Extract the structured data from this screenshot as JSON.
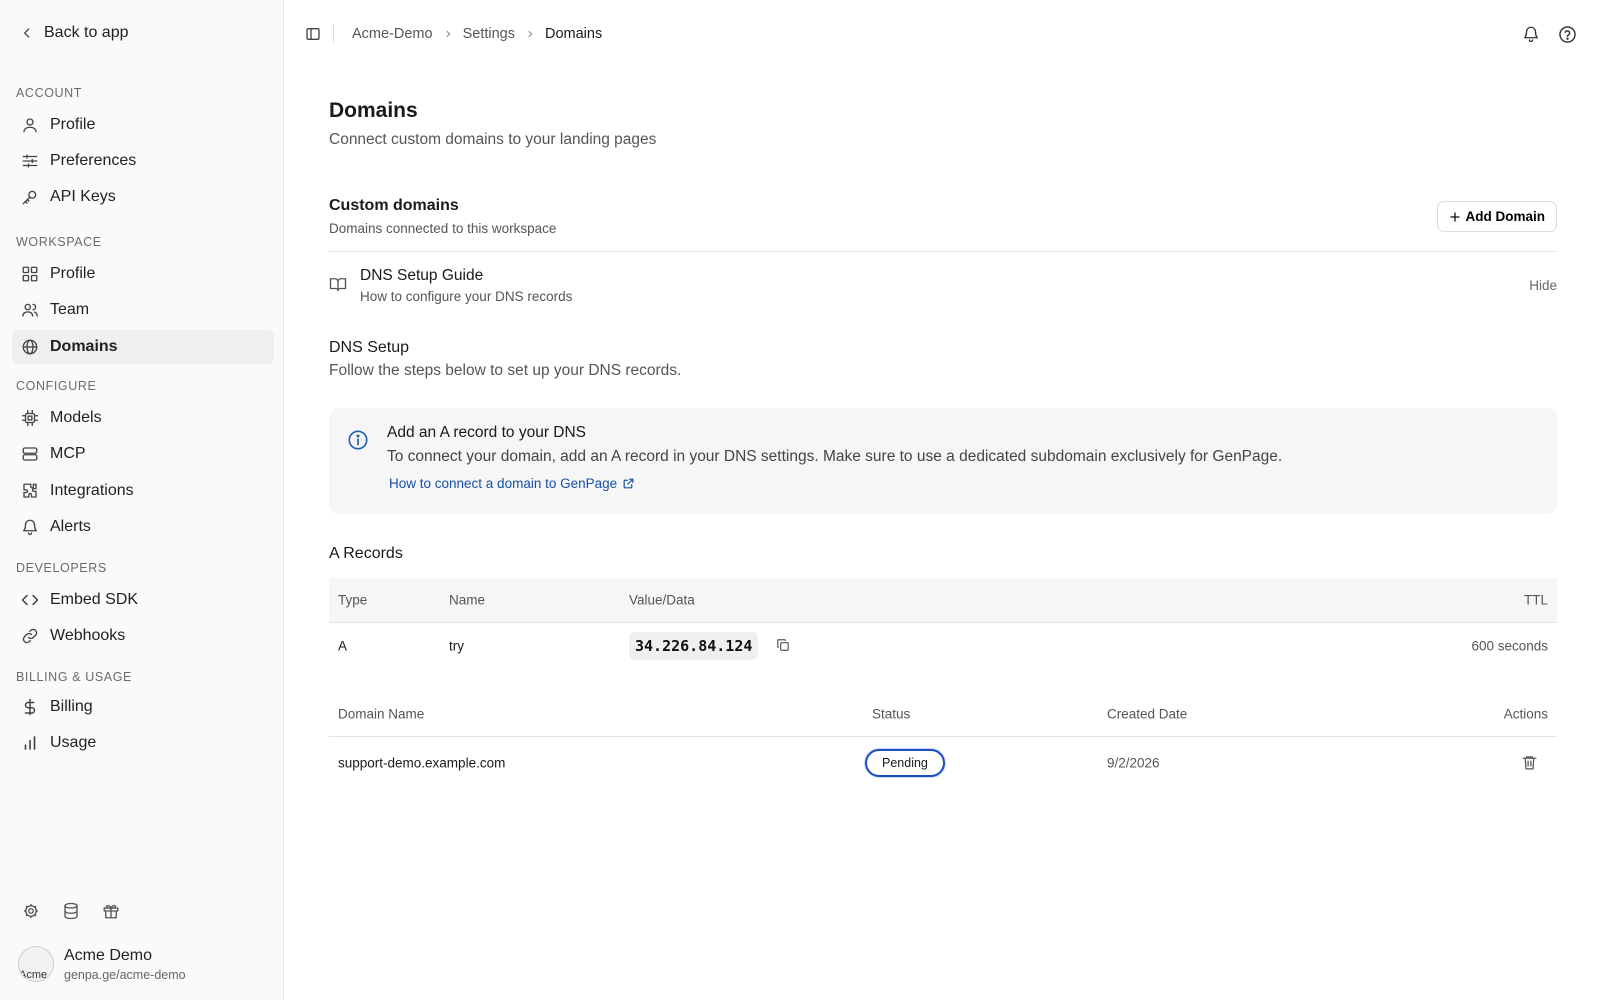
{
  "sidebar": {
    "back_label": "Back to app",
    "sections": [
      {
        "label": "ACCOUNT",
        "items": [
          {
            "label": "Profile",
            "icon": "user-icon"
          },
          {
            "label": "Preferences",
            "icon": "sliders-icon"
          },
          {
            "label": "API Keys",
            "icon": "key-icon"
          }
        ]
      },
      {
        "label": "WORKSPACE",
        "items": [
          {
            "label": "Profile",
            "icon": "grid-icon"
          },
          {
            "label": "Team",
            "icon": "users-icon"
          },
          {
            "label": "Domains",
            "icon": "globe-icon",
            "active": true
          }
        ]
      },
      {
        "label": "CONFIGURE",
        "items": [
          {
            "label": "Models",
            "icon": "cpu-icon"
          },
          {
            "label": "MCP",
            "icon": "server-icon"
          },
          {
            "label": "Integrations",
            "icon": "puzzle-icon"
          },
          {
            "label": "Alerts",
            "icon": "bell-icon"
          }
        ]
      },
      {
        "label": "DEVELOPERS",
        "items": [
          {
            "label": "Embed SDK",
            "icon": "code-icon"
          },
          {
            "label": "Webhooks",
            "icon": "link-icon"
          }
        ]
      },
      {
        "label": "BILLING & USAGE",
        "items": [
          {
            "label": "Billing",
            "icon": "dollar-icon"
          },
          {
            "label": "Usage",
            "icon": "bar-chart-icon"
          }
        ]
      }
    ],
    "account": {
      "avatar_alt": "Acme",
      "name": "Acme Demo",
      "url": "genpa.ge/acme-demo"
    }
  },
  "breadcrumb": [
    "Acme-Demo",
    "Settings",
    "Domains"
  ],
  "page": {
    "title": "Domains",
    "subtitle": "Connect custom domains to your landing pages"
  },
  "custom_domains": {
    "title": "Custom domains",
    "subtitle": "Domains connected to this workspace",
    "add_label": "Add Domain"
  },
  "guide": {
    "title": "DNS Setup Guide",
    "subtitle": "How to configure your DNS records",
    "hide_label": "Hide"
  },
  "dns_setup": {
    "title": "DNS Setup",
    "subtitle": "Follow the steps below to set up your DNS records."
  },
  "info": {
    "title": "Add an A record to your DNS",
    "body": "To connect your domain, add an A record in your DNS settings. Make sure to use a dedicated subdomain exclusively for GenPage.",
    "link": "How to connect a domain to GenPage"
  },
  "a_records": {
    "title": "A Records",
    "headers": {
      "type": "Type",
      "name": "Name",
      "value": "Value/Data",
      "ttl": "TTL"
    },
    "row": {
      "type": "A",
      "name": "try",
      "value": "34.226.84.124",
      "ttl": "600 seconds"
    }
  },
  "domains_table": {
    "headers": {
      "domain": "Domain Name",
      "status": "Status",
      "created": "Created Date",
      "actions": "Actions"
    },
    "row": {
      "domain": "support-demo.example.com",
      "status": "Pending",
      "created": "9/2/2026"
    }
  },
  "colors": {
    "accent_link": "#1650a8",
    "status_pending_border": "#1a4fc4",
    "info_icon": "#1f5fb0"
  }
}
